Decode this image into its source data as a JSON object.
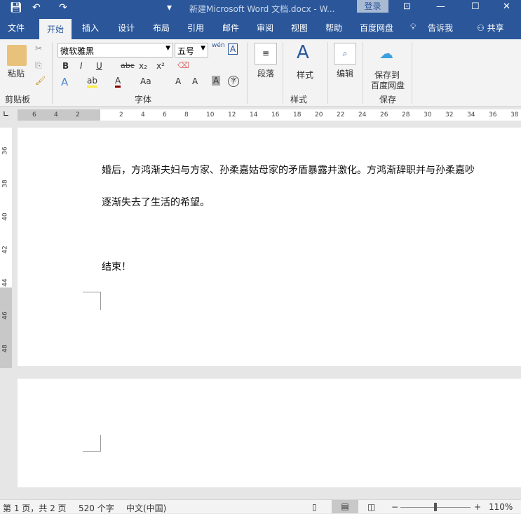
{
  "titlebar": {
    "title": "新建Microsoft Word 文档.docx  -  W...",
    "login": "登录"
  },
  "menu": [
    "文件",
    "开始",
    "插入",
    "设计",
    "布局",
    "引用",
    "邮件",
    "审阅",
    "视图",
    "帮助",
    "百度网盘",
    "告诉我",
    "共享"
  ],
  "ribbon": {
    "paste": "粘贴",
    "clipboard": "剪贴板",
    "font_name": "微软雅黑",
    "font_size": "五号",
    "font_group": "字体",
    "paragraph": "段落",
    "styles": "样式",
    "styles_group": "样式",
    "edit": "编辑",
    "save_to": "保存到",
    "baidu": "百度网盘",
    "save_group": "保存",
    "bold": "B",
    "italic": "I",
    "underline": "U",
    "strike": "abc",
    "sub": "x₂",
    "sup": "x²",
    "aa": "Aa",
    "grow": "A",
    "shrink": "A",
    "shade": "A",
    "char": "字",
    "wen": "wén"
  },
  "ruler": {
    "ticks": [
      "6",
      "4",
      "2",
      "2",
      "4",
      "6",
      "8",
      "10",
      "12",
      "14",
      "16",
      "18",
      "20",
      "22",
      "24",
      "26",
      "28",
      "30",
      "32",
      "34",
      "36",
      "38"
    ],
    "vticks": [
      "36",
      "38",
      "40",
      "42",
      "44",
      "46",
      "48"
    ]
  },
  "document": {
    "lines": [
      "婚后，方鸿渐夫妇与方家、孙柔嘉姑母家的矛盾暴露并激化。方鸿渐辞职并与孙柔嘉吵",
      "逐渐失去了生活的希望。",
      "结束！"
    ]
  },
  "status": {
    "page": "第 1 页，共 2 页",
    "words": "520 个字",
    "lang": "中文(中国)",
    "zoom": "110%",
    "zoom_minus": "−",
    "zoom_plus": "+"
  }
}
